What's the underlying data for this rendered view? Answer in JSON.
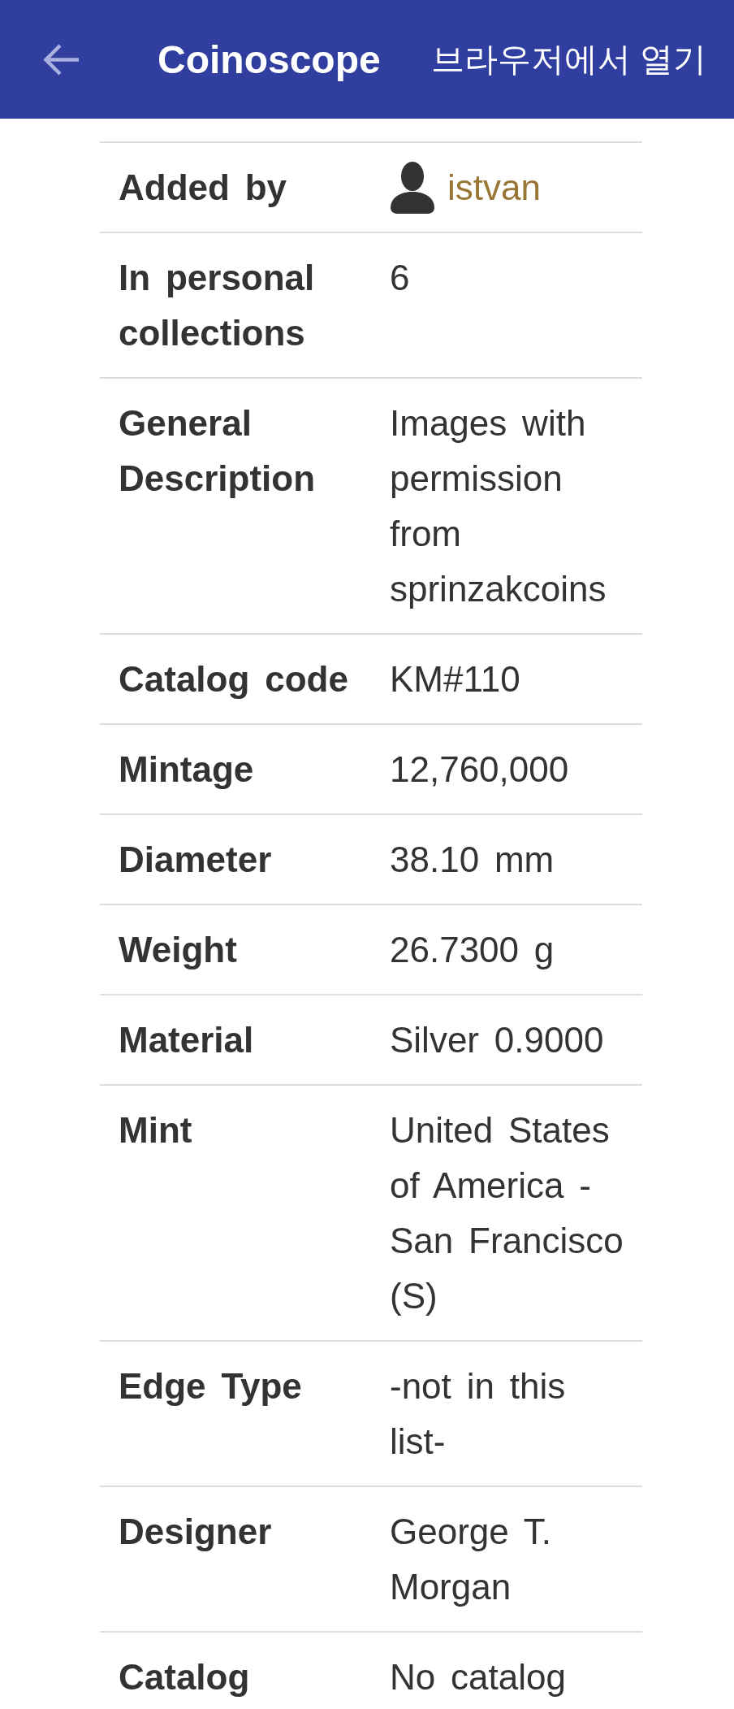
{
  "app_bar": {
    "title": "Coinoscope",
    "action": "브라우저에서 열기"
  },
  "details": [
    {
      "kind": "user",
      "label": "Added by",
      "value": "istvan"
    },
    {
      "kind": "text",
      "label": "In personal collections",
      "value": "6"
    },
    {
      "kind": "text",
      "label": "General Description",
      "value": "Images with permission from sprinzakcoins"
    },
    {
      "kind": "text",
      "label": "Catalog code",
      "value": "KM#110"
    },
    {
      "kind": "text",
      "label": "Mintage",
      "value": "12,760,000"
    },
    {
      "kind": "text",
      "label": "Diameter",
      "value": "38.10 mm"
    },
    {
      "kind": "text",
      "label": "Weight",
      "value": "26.7300 g"
    },
    {
      "kind": "text",
      "label": "Material",
      "value": "Silver 0.9000"
    },
    {
      "kind": "text",
      "label": "Mint",
      "value": "United States of America - San Francisco (S)"
    },
    {
      "kind": "text",
      "label": "Edge Type",
      "value": "-not in this list-"
    },
    {
      "kind": "text",
      "label": "Designer",
      "value": "George T. Morgan"
    },
    {
      "kind": "text",
      "label": "Catalog",
      "value": "No catalog"
    }
  ]
}
